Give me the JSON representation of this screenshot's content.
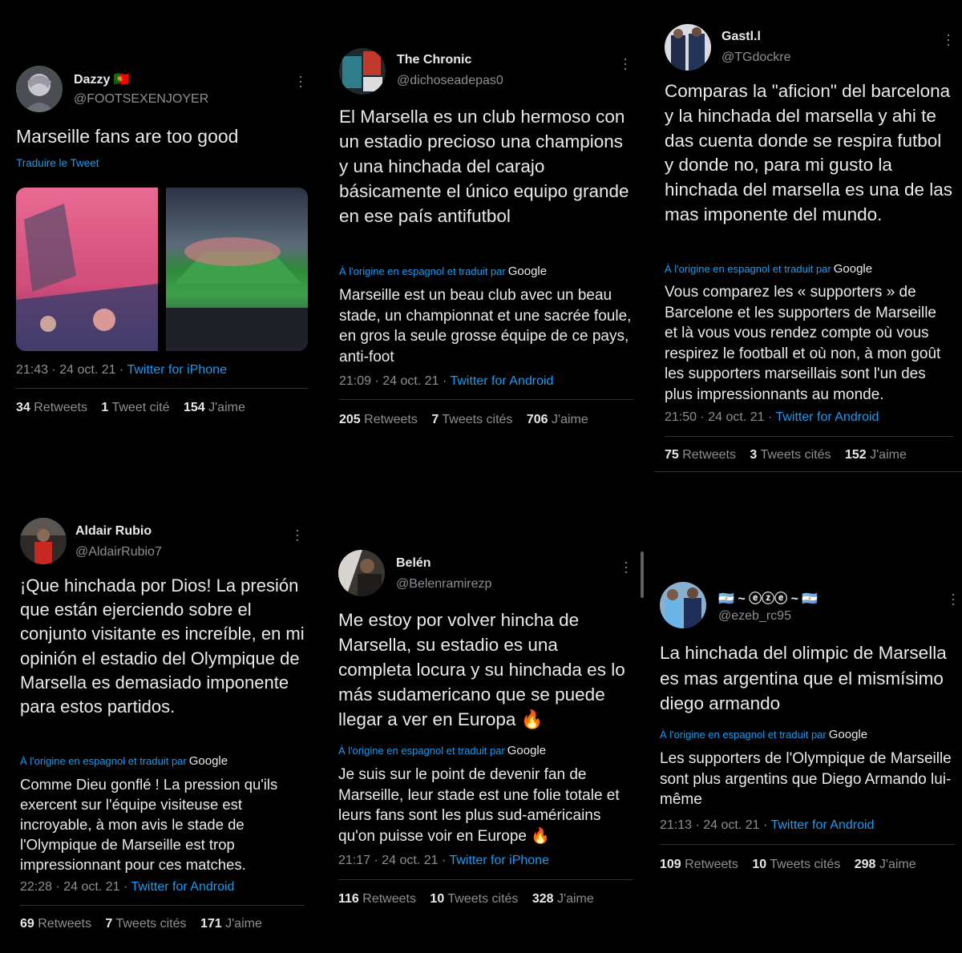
{
  "tweets": [
    {
      "name": "Dazzy 🇵🇹",
      "handle": "@FOOTSEXENJOYER",
      "text": "Marseille fans are too good",
      "translate_link": "Traduire le Tweet",
      "time": "21:43 · 24 oct. 21 · ",
      "source": "Twitter for iPhone",
      "retweets": "34",
      "retweets_label": "Retweets",
      "quotes": "1",
      "quotes_label": "Tweet cité",
      "likes": "154",
      "likes_label": "J'aime"
    },
    {
      "name": "The Chronic",
      "handle": "@dichoseadepas0",
      "text": "El Marsella es un club hermoso con un estadio precioso una champions y una hinchada del carajo básicamente el único equipo grande en ese país antifutbol",
      "translation_note": "À l'origine en espagnol et traduit par",
      "translation_brand": "Google",
      "translation": "Marseille est un beau club avec un beau stade, un championnat et une sacrée foule, en gros la seule grosse équipe de ce pays, anti-foot",
      "time": "21:09 · 24 oct. 21 · ",
      "source": "Twitter for Android",
      "retweets": "205",
      "retweets_label": "Retweets",
      "quotes": "7",
      "quotes_label": "Tweets cités",
      "likes": "706",
      "likes_label": "J'aime"
    },
    {
      "name": "Gastl.l",
      "handle": "@TGdockre",
      "text": "Comparas la \"aficion\" del barcelona y la hinchada del marsella y ahi te das cuenta donde se respira futbol y donde no, para mi gusto la hinchada del marsella es una de las mas imponente del mundo.",
      "translation_note": "À l'origine en espagnol et traduit par",
      "translation_brand": "Google",
      "translation": "Vous comparez les « supporters » de Barcelone et les supporters de Marseille et là vous vous rendez compte où vous respirez le football et où non, à mon goût les supporters marseillais sont l'un des plus impressionnants au monde.",
      "time": "21:50 · 24 oct. 21 · ",
      "source": "Twitter for Android",
      "retweets": "75",
      "retweets_label": "Retweets",
      "quotes": "3",
      "quotes_label": "Tweets cités",
      "likes": "152",
      "likes_label": "J'aime"
    },
    {
      "name": "Aldair Rubio",
      "handle": "@AldairRubio7",
      "text": "¡Que hinchada por Dios! La presión que están ejerciendo sobre el conjunto visitante es increíble, en mi opinión el estadio del Olympique de Marsella es demasiado imponente para estos partidos.",
      "translation_note": "À l'origine en espagnol et traduit par",
      "translation_brand": "Google",
      "translation": "Comme Dieu gonflé ! La pression qu'ils exercent sur l'équipe visiteuse est incroyable, à mon avis le stade de l'Olympique de Marseille est trop impressionnant pour ces matches.",
      "time": "22:28 · 24 oct. 21 · ",
      "source": "Twitter for Android",
      "retweets": "69",
      "retweets_label": "Retweets",
      "quotes": "7",
      "quotes_label": "Tweets cités",
      "likes": "171",
      "likes_label": "J'aime"
    },
    {
      "name": "Belén",
      "handle": "@Belenramirezp",
      "text": "Me estoy por volver hincha de Marsella, su estadio es una completa locura y su hinchada es lo más sudamericano que se puede llegar a ver en Europa 🔥",
      "translation_note": "À l'origine en espagnol et traduit par",
      "translation_brand": "Google",
      "translation": "Je suis sur le point de devenir fan de Marseille, leur stade est une folie totale et leurs fans sont les plus sud-américains qu'on puisse voir en Europe 🔥",
      "time": "21:17 · 24 oct. 21 · ",
      "source": "Twitter for iPhone",
      "retweets": "116",
      "retweets_label": "Retweets",
      "quotes": "10",
      "quotes_label": "Tweets cités",
      "likes": "328",
      "likes_label": "J'aime"
    },
    {
      "name": "🇦🇷 ~ ⓔⓩⓔ ~ 🇦🇷",
      "handle": "@ezeb_rc95",
      "text": "La hinchada del olimpic de Marsella es mas argentina que el mismísimo diego armando",
      "translation_note": "À l'origine en espagnol et traduit par",
      "translation_brand": "Google",
      "translation": "Les supporters de l'Olympique de Marseille sont plus argentins que Diego Armando lui-même",
      "time": "21:13 · 24 oct. 21 · ",
      "source": "Twitter for Android",
      "retweets": "109",
      "retweets_label": "Retweets",
      "quotes": "10",
      "quotes_label": "Tweets cités",
      "likes": "298",
      "likes_label": "J'aime"
    }
  ],
  "colors": {
    "background": "#000000",
    "text": "#e7e9ea",
    "secondary": "#8b8f94",
    "link": "#1d9bf0",
    "separator": "#2f3336"
  }
}
